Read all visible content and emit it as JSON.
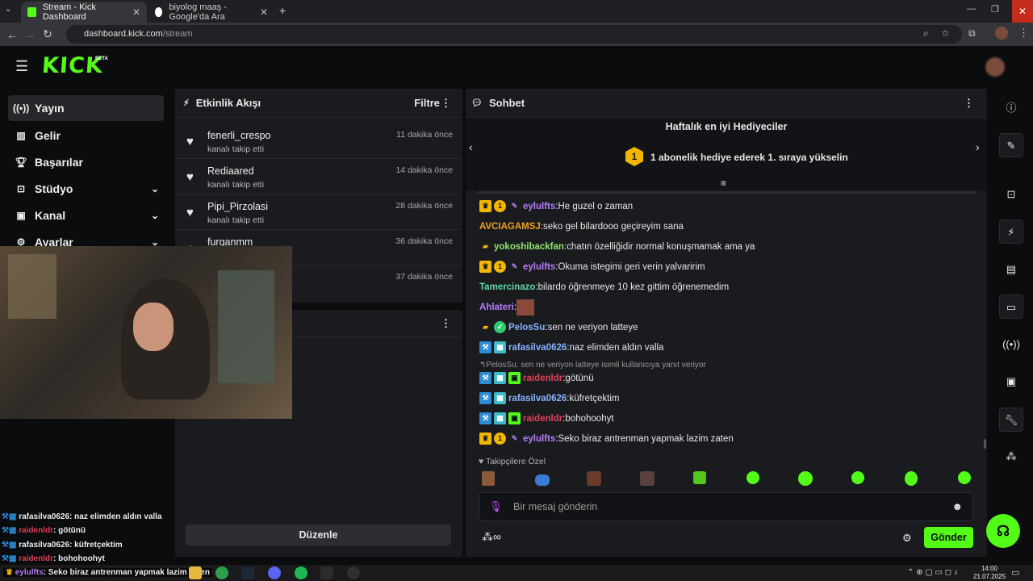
{
  "browser": {
    "tabs": [
      {
        "title": "Stream - Kick Dashboard",
        "active": true
      },
      {
        "title": "biyolog maaş - Google'da Ara",
        "active": false
      }
    ],
    "url_host": "dashboard.kick.com",
    "url_path": "/stream"
  },
  "brand": {
    "logo": "KICK",
    "badge": "BETA",
    "accent": "#53fc18"
  },
  "sidebar": {
    "items": [
      {
        "label": "Yayın",
        "icon": "broadcast-icon",
        "active": true
      },
      {
        "label": "Gelir",
        "icon": "chart-icon"
      },
      {
        "label": "Başarılar",
        "icon": "trophy-icon"
      },
      {
        "label": "Stüdyo",
        "icon": "studio-icon",
        "expandable": true
      },
      {
        "label": "Kanal",
        "icon": "channel-icon",
        "expandable": true
      },
      {
        "label": "Ayarlar",
        "icon": "settings-icon",
        "expandable": true
      }
    ]
  },
  "activity": {
    "title": "Etkinlik Akışı",
    "filter_label": "Filtre",
    "events": [
      {
        "name": "fenerli_crespo",
        "action": "kanalı takip etti",
        "time": "11 dakika önce"
      },
      {
        "name": "Rediaared",
        "action": "kanalı takip etti",
        "time": "14 dakika önce"
      },
      {
        "name": "Pipi_Pirzolasi",
        "action": "kanalı takip etti",
        "time": "28 dakika önce"
      },
      {
        "name": "furqanmm",
        "action": "",
        "time": "36 dakika önce"
      },
      {
        "name": "",
        "action": "",
        "time": "37 dakika önce"
      }
    ],
    "edit_label": "Düzenle"
  },
  "chat": {
    "title": "Sohbet",
    "gifters_title": "Haftalık en iyi Hediyeciler",
    "gifters_rank": "1",
    "gifters_cta": "1 abonelik hediye ederek 1. sıraya yükselin",
    "messages": [
      {
        "badges": [
          "crown",
          "sub",
          "pen"
        ],
        "user": "eylulfts",
        "color": "#b77ef7",
        "text": "He guzel o zaman"
      },
      {
        "badges": [],
        "user": "AVCIAGAMSJ",
        "color": "#f0a020",
        "text": "seko gel bilardooo geçireyim sana"
      },
      {
        "badges": [
          "bread"
        ],
        "user": "yokoshibackfan",
        "color": "#92e86b",
        "text": "chatın özelliğidir normal konuşmamak ama ya"
      },
      {
        "badges": [
          "crown",
          "sub",
          "pen"
        ],
        "user": "eylulfts",
        "color": "#b77ef7",
        "text": "Okuma istegimi geri verin yalvaririm"
      },
      {
        "badges": [],
        "user": "Tamercinazo",
        "color": "#5ed8a8",
        "text": "bilardo öğrenmeye 10 kez gittim öğrenemedim"
      },
      {
        "badges": [],
        "user": "Ahlateri",
        "color": "#b77ef7",
        "text": "",
        "emote": true
      },
      {
        "badges": [
          "bread",
          "ver"
        ],
        "user": "PelosSu",
        "color": "#8ab4ff",
        "text": "sen ne veriyon latteye"
      },
      {
        "badges": [
          "ham",
          "og"
        ],
        "user": "rafasilva0626",
        "color": "#8ab4ff",
        "text": "naz elimden aldın valla"
      },
      {
        "badges": [
          "ham",
          "og",
          "gift"
        ],
        "user": "raidenldr",
        "color": "#e0405a",
        "text": "götünü",
        "reply": "PelosSu: sen ne veriyon latteye isimli kullanıcıya yanıt veriyor"
      },
      {
        "badges": [
          "ham",
          "og"
        ],
        "user": "rafasilva0626",
        "color": "#8ab4ff",
        "text": "küfretçektim"
      },
      {
        "badges": [
          "ham",
          "og",
          "gift"
        ],
        "user": "raidenldr",
        "color": "#e0405a",
        "text": "bohohoohyt"
      },
      {
        "badges": [
          "crown",
          "sub",
          "pen"
        ],
        "user": "eylulfts",
        "color": "#b77ef7",
        "text": "Seko biraz antrenman yapmak lazim zaten"
      }
    ],
    "followers_only_label": "Takipçilere Özel",
    "input_placeholder": "Bir mesaj gönderin",
    "send_label": "Gönder"
  },
  "overlay_chat": [
    {
      "user": "rafasilva0626",
      "text": ": naz elimden aldın valla",
      "color": "#8ab4ff"
    },
    {
      "user": "raidenldr",
      "text": ": götünü",
      "color": "#e0405a"
    },
    {
      "user": "rafasilva0626",
      "text": ": küfretçektim",
      "color": "#8ab4ff"
    },
    {
      "user": "raidenldr",
      "text": ": bohohoohyt",
      "color": "#e0405a"
    },
    {
      "user": "eylulfts",
      "text": ": Seko biraz antrenman yapmak lazim zaten",
      "color": "#b77ef7"
    }
  ],
  "taskbar": {
    "time": "14:00",
    "date": "21.07.2025"
  }
}
